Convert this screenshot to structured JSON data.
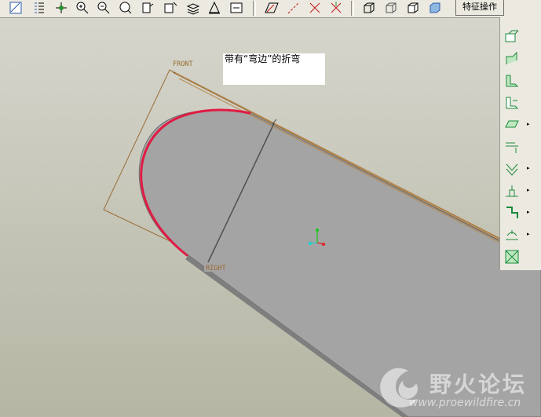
{
  "toolbar": {
    "buttons": [
      "sketch-icon",
      "layer-tree-icon",
      "spin-center-icon",
      "zoom-in-icon",
      "zoom-out-icon",
      "refit-icon",
      "orient-icon",
      "saved-views-icon",
      "layers-icon",
      "model-display-icon",
      "repaint-icon",
      "datum-plane-icon",
      "datum-axis-icon",
      "datum-point-icon",
      "csys-icon",
      "wireframe-icon",
      "hidden-line-icon",
      "no-hidden-icon",
      "shaded-icon"
    ],
    "feature_ops_label": "特征操作"
  },
  "right_toolbar": {
    "buttons": [
      "unbend-icon",
      "bend-back-icon",
      "flat-wall-icon",
      "flange-wall-icon",
      "extruded-wall-icon",
      "rip-icon",
      "punch-icon",
      "form-icon",
      "bend-icon",
      "flatten-icon",
      "corner-relief-icon"
    ],
    "flyout_glyph": "▸"
  },
  "annotation": {
    "text": "带有“弯边”的折弯"
  },
  "datums": {
    "front_label": "FRONT",
    "right_label": "RIGHT"
  },
  "watermark": {
    "name": "野火论坛",
    "url": "www.proewildfire.cn"
  },
  "colors": {
    "part_fill": "#a4a4a4",
    "datum_plane": "#9a6c34",
    "selected_edge": "#e01b43",
    "background": "#cfcfc4"
  }
}
